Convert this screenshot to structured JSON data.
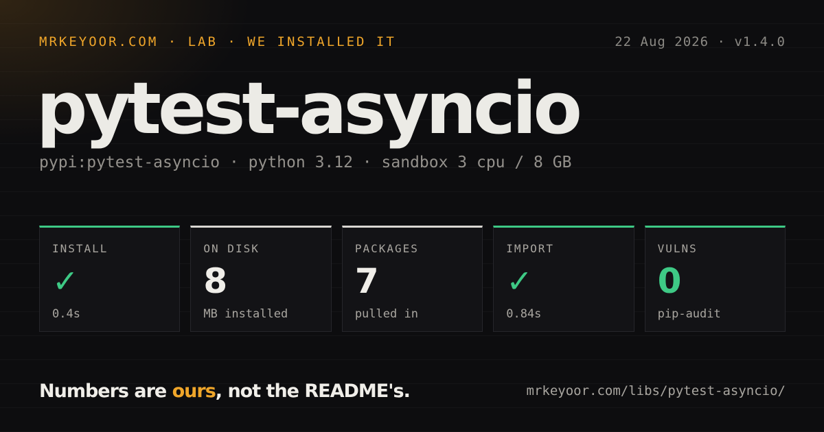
{
  "header": {
    "kicker": "MRKEYOOR.COM · LAB · WE INSTALLED IT",
    "meta": "22 Aug 2026 · v1.4.0"
  },
  "package": {
    "name": "pytest-asyncio",
    "details": "pypi:pytest-asyncio · python 3.12 · sandbox 3 cpu / 8 GB"
  },
  "stats": [
    {
      "label": "INSTALL",
      "value": "✓",
      "sub": "0.4s",
      "status": "ok",
      "value_color": "#3ec985"
    },
    {
      "label": "ON DISK",
      "value": "8",
      "sub": "MB installed",
      "status": "neutral"
    },
    {
      "label": "PACKAGES",
      "value": "7",
      "sub": "pulled in",
      "status": "neutral"
    },
    {
      "label": "IMPORT",
      "value": "✓",
      "sub": "0.84s",
      "status": "ok",
      "value_color": "#3ec985"
    },
    {
      "label": "VULNS",
      "value": "0",
      "sub": "pip-audit",
      "status": "ok",
      "value_color": "#3ec985"
    }
  ],
  "footer": {
    "tagline_prefix": "Numbers are ",
    "tagline_accent": "ours",
    "tagline_suffix": ", not the README's.",
    "url": "mrkeyoor.com/libs/pytest-asyncio/"
  },
  "colors": {
    "accent_orange": "#f0a62a",
    "accent_green": "#3ec985",
    "background": "#0d0d0f",
    "neutral_bar": "#d9d7d2"
  }
}
